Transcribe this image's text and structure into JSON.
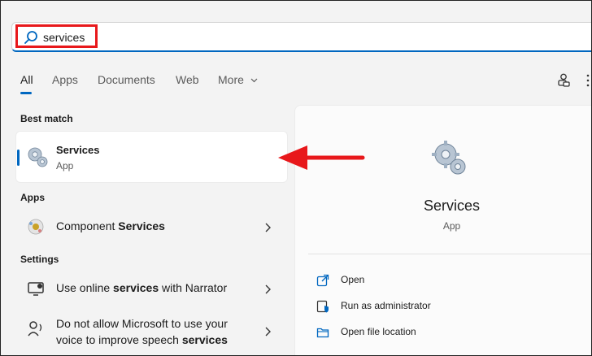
{
  "search": {
    "value": "services",
    "placeholder": ""
  },
  "tabs": [
    {
      "label": "All",
      "active": true
    },
    {
      "label": "Apps"
    },
    {
      "label": "Documents"
    },
    {
      "label": "Web"
    },
    {
      "label": "More"
    }
  ],
  "best_match": {
    "heading": "Best match",
    "title": "Services",
    "subtitle": "App"
  },
  "apps": {
    "heading": "Apps",
    "items": [
      {
        "prefix": "Component ",
        "bold": "Services",
        "suffix": ""
      }
    ]
  },
  "settings": {
    "heading": "Settings",
    "items": [
      {
        "prefix": "Use online ",
        "bold": "services",
        "suffix": " with Narrator"
      },
      {
        "line1": "Do not allow Microsoft to use your",
        "line2_prefix": "voice to improve speech ",
        "line2_bold": "services"
      }
    ]
  },
  "preview": {
    "title": "Services",
    "subtitle": "App",
    "actions": [
      {
        "label": "Open"
      },
      {
        "label": "Run as administrator"
      },
      {
        "label": "Open file location"
      }
    ]
  },
  "colors": {
    "accent": "#0067c0",
    "annotation": "#e8181b"
  }
}
